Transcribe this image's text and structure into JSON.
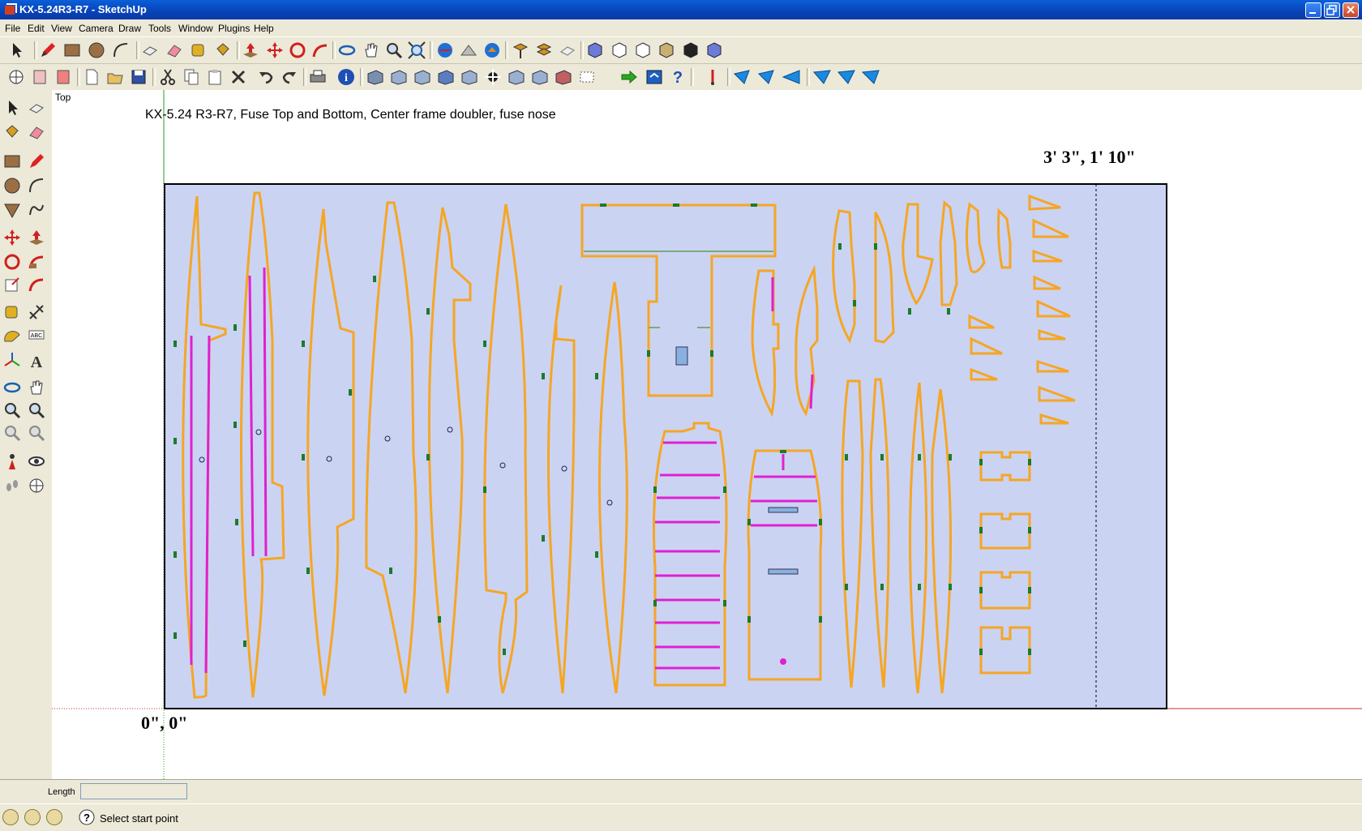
{
  "window": {
    "title": "KX-5.24R3-R7 - SketchUp"
  },
  "menu": [
    "File",
    "Edit",
    "View",
    "Camera",
    "Draw",
    "Tools",
    "Window",
    "Plugins",
    "Help"
  ],
  "viewport": {
    "view_label": "Top",
    "drawing_title": "KX-5.24 R3-R7, Fuse Top and Bottom, Center frame doubler, fuse nose",
    "corner_upper_right": "3' 3\", 1' 10\"",
    "corner_lower_left": "0\", 0\""
  },
  "vcb": {
    "label": "Length",
    "value": ""
  },
  "status": {
    "text": "Select start point"
  },
  "colors": {
    "sheet_fill": "#cbd3f3",
    "part_outline": "#f5a623",
    "tab_marker": "#1d7a2c",
    "slot_line": "#e020d0",
    "title_bar": "#0a4fd0"
  },
  "toolbar_icons": [
    "select-icon",
    "pencil-icon",
    "rectangle-icon",
    "circle-icon",
    "arc-icon",
    "make-component-icon",
    "eraser-icon",
    "tape-measure-icon",
    "paint-bucket-icon",
    "push-pull-icon",
    "move-icon",
    "rotate-icon",
    "follow-me-icon",
    "orbit-icon",
    "pan-icon",
    "zoom-icon",
    "zoom-extents-icon",
    "get-models-icon",
    "share-model-icon",
    "share-component-icon",
    "section-plane-icon",
    "display-section-icon",
    "add-location-icon",
    "iso-view-icon",
    "top-view-icon",
    "front-view-icon",
    "right-view-icon",
    "back-view-icon",
    "left-view-icon"
  ]
}
